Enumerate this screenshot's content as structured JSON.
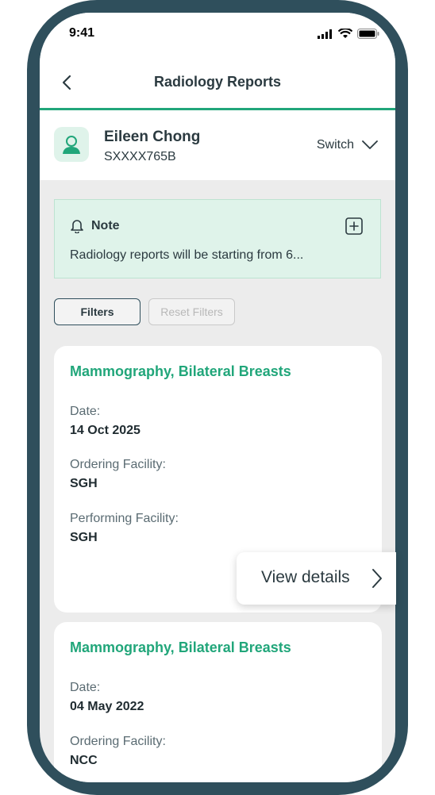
{
  "status_bar": {
    "time": "9:41"
  },
  "header": {
    "title": "Radiology Reports"
  },
  "profile": {
    "name": "Eileen Chong",
    "id": "SXXXX765B",
    "switch_label": "Switch"
  },
  "note": {
    "title": "Note",
    "text": "Radiology reports will be starting from 6..."
  },
  "filters": {
    "filters_label": "Filters",
    "reset_label": "Reset Filters"
  },
  "reports": [
    {
      "title": "Mammography, Bilateral Breasts",
      "date_label": "Date:",
      "date": "14 Oct 2025",
      "ordering_label": "Ordering Facility:",
      "ordering": "SGH",
      "performing_label": "Performing Facility:",
      "performing": "SGH"
    },
    {
      "title": "Mammography, Bilateral Breasts",
      "date_label": "Date:",
      "date": "04 May 2022",
      "ordering_label": "Ordering Facility:",
      "ordering": "NCC"
    }
  ],
  "view_details": {
    "label": "View details"
  },
  "colors": {
    "accent": "#21a67a",
    "frame": "#2f4f5c",
    "note_bg": "#dff3ea"
  }
}
